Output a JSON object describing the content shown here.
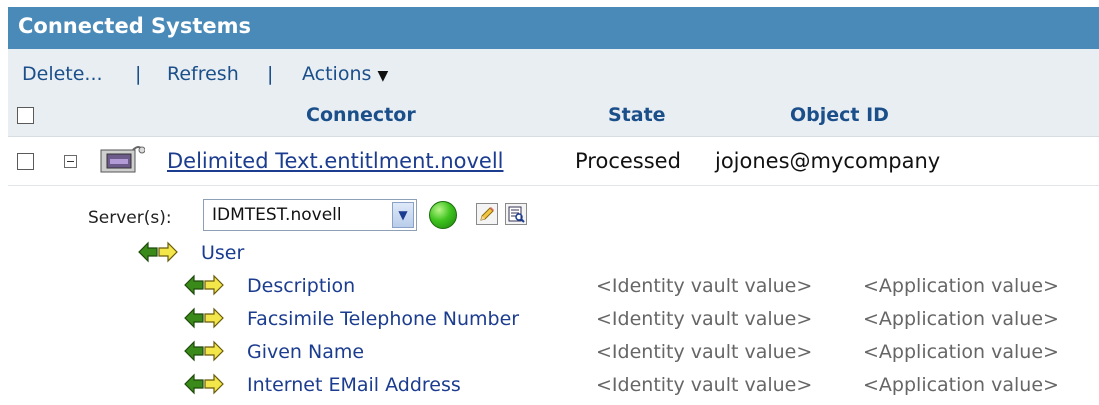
{
  "header": {
    "title": "Connected Systems"
  },
  "toolbar": {
    "delete_label": "Delete...",
    "separator": "|",
    "refresh_label": "Refresh",
    "actions_label": "Actions",
    "actions_arrow": "▼"
  },
  "columns": {
    "connector": "Connector",
    "state": "State",
    "object_id": "Object ID"
  },
  "row": {
    "connector": "Delimited Text.entitlment.novell",
    "state": "Processed",
    "object_id": "jojones@mycompany"
  },
  "server": {
    "label": "Server(s):",
    "selected": "IDMTEST.novell",
    "status_color": "#3ec41e"
  },
  "tree": {
    "root": "User",
    "attributes": [
      {
        "name": "Description",
        "vault": "<Identity vault value>",
        "app": "<Application value>"
      },
      {
        "name": "Facsimile Telephone Number",
        "vault": "<Identity vault value>",
        "app": "<Application value>"
      },
      {
        "name": "Given Name",
        "vault": "<Identity vault value>",
        "app": "<Application value>"
      },
      {
        "name": "Internet EMail Address",
        "vault": "<Identity vault value>",
        "app": "<Application value>"
      }
    ]
  },
  "colors": {
    "header_bg": "#4a8ab8",
    "link": "#1b3c8f",
    "toolbar_bg": "#e9eef3"
  },
  "icons": [
    "connector-icon",
    "sync-arrows-icon",
    "edit-pencil-icon",
    "view-details-icon",
    "status-green-icon"
  ]
}
